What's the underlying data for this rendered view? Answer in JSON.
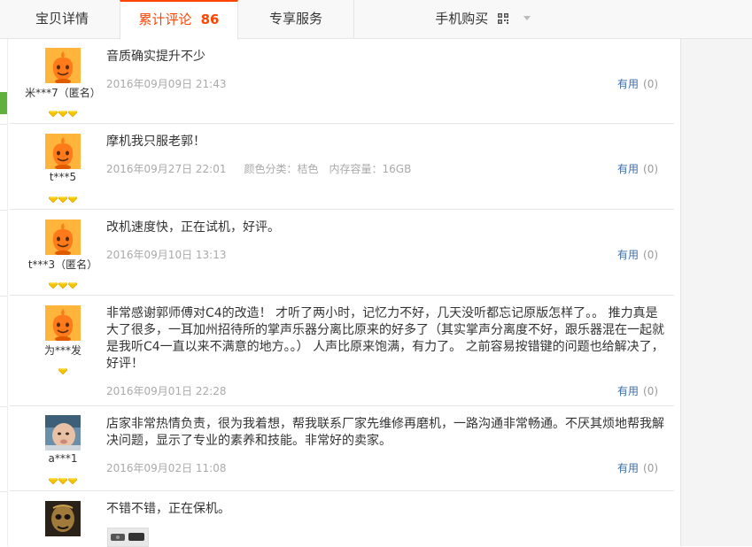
{
  "tabs": [
    {
      "label": "宝贝详情"
    },
    {
      "label": "累计评论",
      "count": "86"
    },
    {
      "label": "专享服务"
    },
    {
      "label": "手机购买"
    }
  ],
  "useful_label": "有用",
  "reviews": [
    {
      "user": "米***7（匿名）",
      "content": "音质确实提升不少",
      "date": "2016年09月09日 21:43",
      "useful_count": "(0)",
      "badges": 3
    },
    {
      "user": "t***5",
      "content": "摩机我只服老郭！",
      "date": "2016年09月27日 22:01",
      "extra1": "颜色分类：桔色",
      "extra2": "内存容量：16GB",
      "useful_count": "(0)",
      "badges": 3
    },
    {
      "user": "t***3（匿名）",
      "content": "改机速度快，正在试机，好评。",
      "date": "2016年09月10日 13:13",
      "useful_count": "(0)",
      "badges": 3
    },
    {
      "user": "为***发",
      "content": "非常感谢郭师傅对C4的改造！ 才听了两小时，记忆力不好，几天没听都忘记原版怎样了。。 推力真是大了很多，一耳加州招待所的掌声乐器分离比原来的好多了（其实掌声分离度不好，跟乐器混在一起就是我听C4一直以来不满意的地方。。） 人声比原来饱满，有力了。 之前容易按错键的问题也给解决了，好评！",
      "date": "2016年09月01日 22:28",
      "useful_count": "(0)",
      "badges": 1
    },
    {
      "user": "a***1",
      "content": "店家非常热情负责，很为我着想，帮我联系厂家先维修再磨机，一路沟通非常畅通。不厌其烦地帮我解决问题，显示了专业的素养和技能。非常好的卖家。",
      "date": "2016年09月02日 11:08",
      "useful_count": "(0)",
      "badges": 3
    },
    {
      "user": "",
      "content": "不错不错，正在保机。",
      "date": "",
      "useful_count": "",
      "badges": 0
    }
  ],
  "colors": {
    "accent": "#ff4400",
    "link": "#3c6faa",
    "badge": "#f5c400",
    "green": "#5fb13c"
  }
}
